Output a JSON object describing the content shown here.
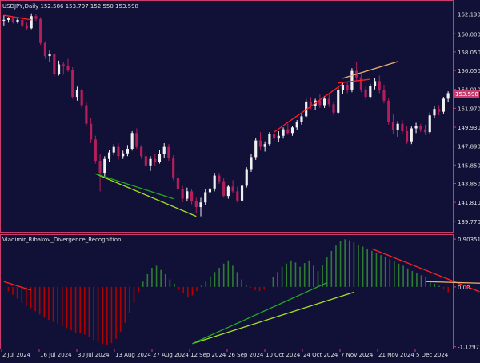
{
  "chart_data": [
    {
      "type": "candlestick",
      "symbol_label": "USDJPY,Daily  152.586 153.797 152.550 153.598",
      "ylim": [
        138.8,
        163.3
      ],
      "y_ticks": [
        "162.130",
        "160.000",
        "158.050",
        "156.050",
        "154.010",
        "151.970",
        "149.930",
        "147.890",
        "145.850",
        "143.850",
        "141.810",
        "139.770"
      ],
      "current_price_label": "153.598",
      "x_ticks": [
        "2 Jul 2024",
        "16 Jul 2024",
        "30 Jul 2024",
        "13 Aug 2024",
        "27 Aug 2024",
        "12 Sep 2024",
        "26 Sep 2024",
        "10 Oct 2024",
        "24 Oct 2024",
        "7 Nov 2024",
        "21 Nov 2024",
        "5 Dec 2024"
      ],
      "colors": {
        "bull": "#f0f0f0",
        "bear": "#b41e5a",
        "bg": "#111137",
        "frame": "#c83c6e",
        "text": "#e0e0e0"
      },
      "candles_ohlc": [
        [
          161.5,
          162.0,
          160.9,
          161.5
        ],
        [
          161.5,
          161.8,
          161.2,
          161.7
        ],
        [
          161.7,
          161.8,
          161.1,
          161.3
        ],
        [
          161.3,
          161.8,
          161.1,
          161.5
        ],
        [
          161.5,
          161.9,
          160.7,
          160.9
        ],
        [
          160.9,
          161.2,
          160.4,
          160.6
        ],
        [
          160.6,
          162.2,
          160.5,
          161.9
        ],
        [
          161.9,
          162.1,
          161.4,
          161.6
        ],
        [
          161.6,
          161.8,
          158.8,
          159.0
        ],
        [
          159.0,
          159.2,
          157.3,
          157.6
        ],
        [
          157.6,
          158.2,
          157.0,
          157.8
        ],
        [
          157.8,
          157.9,
          155.4,
          155.7
        ],
        [
          155.7,
          157.1,
          155.5,
          156.7
        ],
        [
          156.7,
          157.0,
          155.6,
          156.5
        ],
        [
          156.5,
          157.3,
          155.9,
          156.1
        ],
        [
          156.1,
          156.4,
          153.0,
          153.2
        ],
        [
          153.2,
          154.3,
          152.8,
          153.9
        ],
        [
          153.9,
          154.1,
          152.0,
          152.3
        ],
        [
          152.3,
          152.6,
          150.0,
          150.3
        ],
        [
          150.3,
          150.9,
          148.2,
          148.6
        ],
        [
          148.6,
          149.0,
          146.0,
          146.3
        ],
        [
          146.3,
          147.0,
          143.0,
          145.0
        ],
        [
          145.0,
          146.8,
          144.5,
          146.5
        ],
        [
          146.5,
          147.5,
          146.2,
          147.2
        ],
        [
          147.2,
          148.1,
          146.9,
          147.8
        ],
        [
          147.8,
          148.2,
          146.4,
          146.8
        ],
        [
          146.8,
          147.4,
          146.5,
          147.1
        ],
        [
          147.1,
          148.0,
          146.8,
          147.6
        ],
        [
          147.6,
          149.5,
          147.4,
          149.3
        ],
        [
          149.3,
          149.8,
          147.6,
          147.8
        ],
        [
          147.8,
          148.0,
          146.5,
          146.8
        ],
        [
          146.8,
          147.3,
          145.6,
          145.8
        ],
        [
          145.8,
          146.8,
          145.2,
          146.5
        ],
        [
          146.5,
          147.0,
          145.8,
          146.2
        ],
        [
          146.2,
          147.5,
          146.0,
          147.0
        ],
        [
          147.0,
          148.2,
          146.6,
          147.8
        ],
        [
          147.8,
          148.1,
          146.3,
          146.6
        ],
        [
          146.6,
          146.9,
          144.2,
          144.5
        ],
        [
          144.5,
          145.0,
          143.0,
          143.2
        ],
        [
          143.2,
          143.6,
          141.8,
          142.2
        ],
        [
          142.2,
          143.4,
          141.9,
          143.0
        ],
        [
          143.0,
          143.2,
          141.6,
          141.9
        ],
        [
          141.9,
          142.3,
          140.6,
          141.3
        ],
        [
          141.3,
          142.3,
          140.3,
          141.8
        ],
        [
          141.8,
          143.2,
          141.5,
          142.9
        ],
        [
          142.9,
          143.5,
          142.6,
          143.3
        ],
        [
          143.3,
          145.0,
          143.0,
          144.7
        ],
        [
          144.7,
          145.0,
          143.8,
          144.1
        ],
        [
          144.1,
          144.4,
          142.3,
          142.5
        ],
        [
          142.5,
          143.7,
          142.2,
          143.5
        ],
        [
          143.5,
          144.2,
          142.8,
          143.0
        ],
        [
          143.0,
          143.5,
          141.8,
          142.0
        ],
        [
          142.0,
          143.9,
          141.8,
          143.6
        ],
        [
          143.6,
          145.6,
          143.4,
          145.4
        ],
        [
          145.4,
          147.0,
          145.1,
          146.7
        ],
        [
          146.7,
          148.8,
          146.4,
          148.5
        ],
        [
          148.5,
          149.4,
          147.5,
          147.8
        ],
        [
          147.8,
          148.4,
          147.3,
          148.1
        ],
        [
          148.1,
          149.4,
          147.9,
          149.2
        ],
        [
          149.2,
          149.6,
          148.4,
          148.7
        ],
        [
          148.7,
          149.5,
          148.3,
          149.0
        ],
        [
          149.0,
          149.9,
          148.7,
          149.7
        ],
        [
          149.7,
          150.3,
          149.1,
          149.3
        ],
        [
          149.3,
          150.1,
          149.0,
          149.9
        ],
        [
          149.9,
          150.7,
          149.6,
          150.5
        ],
        [
          150.5,
          151.3,
          150.2,
          151.1
        ],
        [
          151.1,
          153.0,
          150.9,
          152.7
        ],
        [
          152.7,
          153.2,
          151.9,
          152.2
        ],
        [
          152.2,
          153.0,
          151.8,
          152.8
        ],
        [
          152.8,
          153.5,
          152.0,
          152.3
        ],
        [
          152.3,
          153.3,
          152.0,
          153.0
        ],
        [
          153.0,
          153.5,
          152.1,
          152.4
        ],
        [
          152.4,
          152.7,
          151.2,
          151.5
        ],
        [
          151.5,
          154.2,
          151.3,
          153.9
        ],
        [
          153.9,
          154.7,
          153.5,
          154.5
        ],
        [
          154.5,
          154.8,
          153.6,
          153.9
        ],
        [
          153.9,
          156.3,
          153.7,
          156.0
        ],
        [
          156.0,
          157.0,
          154.9,
          155.3
        ],
        [
          155.3,
          155.6,
          153.7,
          154.0
        ],
        [
          154.0,
          154.3,
          152.9,
          153.2
        ],
        [
          153.2,
          154.6,
          153.0,
          154.4
        ],
        [
          154.4,
          155.2,
          154.0,
          154.9
        ],
        [
          154.9,
          155.5,
          153.6,
          153.9
        ],
        [
          153.9,
          154.5,
          152.5,
          152.8
        ],
        [
          152.8,
          153.1,
          150.2,
          150.5
        ],
        [
          150.5,
          151.3,
          149.2,
          149.6
        ],
        [
          149.6,
          150.6,
          148.9,
          150.3
        ],
        [
          150.3,
          150.7,
          149.2,
          149.5
        ],
        [
          149.5,
          150.0,
          148.1,
          148.4
        ],
        [
          148.4,
          150.0,
          148.1,
          149.8
        ],
        [
          149.8,
          150.4,
          149.3,
          150.1
        ],
        [
          150.1,
          150.3,
          149.4,
          149.7
        ],
        [
          149.7,
          150.2,
          149.1,
          149.4
        ],
        [
          149.4,
          151.5,
          149.2,
          151.2
        ],
        [
          151.2,
          152.2,
          150.9,
          151.9
        ],
        [
          151.9,
          152.3,
          151.2,
          151.6
        ],
        [
          151.6,
          153.2,
          151.4,
          153.0
        ],
        [
          153.0,
          153.8,
          152.6,
          153.6
        ]
      ],
      "annotations": [
        {
          "price_panel_lines": [
            {
              "from": [
                0,
                162.0
              ],
              "to": [
                6,
                161.5
              ],
              "color": "#ff2020"
            },
            {
              "from": [
                20,
                144.9
              ],
              "to": [
                42,
                140.3
              ],
              "color": "#a8e020"
            },
            {
              "from": [
                20,
                144.9
              ],
              "to": [
                37,
                142.2
              ],
              "color": "#22aa22"
            },
            {
              "from": [
                59,
                149.4
              ],
              "to": [
                74,
                154.6
              ],
              "color": "#ff2020"
            },
            {
              "from": [
                74,
                155.2
              ],
              "to": [
                86,
                157.0
              ],
              "color": "#f0b070"
            },
            {
              "from": [
                73,
                154.7
              ],
              "to": [
                80,
                155.1
              ],
              "color": "#ff2020"
            }
          ]
        }
      ]
    },
    {
      "type": "bar",
      "title": "Vladimir_Ribakov_Divergence_Recognition",
      "ylim": [
        -1.165,
        0.95
      ],
      "y_ticks": [
        "0.903519",
        "0.00",
        "-1.12977"
      ],
      "colors": {
        "positive": "#2e7d32",
        "negative": "#b00000"
      },
      "values": [
        0.0,
        -0.08,
        -0.15,
        -0.22,
        -0.3,
        -0.36,
        -0.4,
        -0.46,
        -0.52,
        -0.58,
        -0.62,
        -0.66,
        -0.7,
        -0.74,
        -0.78,
        -0.82,
        -0.86,
        -0.88,
        -0.9,
        -0.94,
        -1.0,
        -1.04,
        -1.08,
        -1.1,
        -1.06,
        -0.98,
        -0.85,
        -0.68,
        -0.5,
        -0.3,
        -0.1,
        0.1,
        0.24,
        0.36,
        0.4,
        0.32,
        0.24,
        0.14,
        0.06,
        -0.05,
        -0.12,
        -0.2,
        -0.16,
        -0.08,
        0.02,
        0.1,
        0.2,
        0.28,
        0.36,
        0.44,
        0.5,
        0.4,
        0.28,
        0.14,
        0.04,
        -0.02,
        -0.06,
        -0.08,
        -0.05,
        0.0,
        0.18,
        0.28,
        0.38,
        0.44,
        0.5,
        0.46,
        0.38,
        0.45,
        0.5,
        0.4,
        0.3,
        0.42,
        0.56,
        0.68,
        0.78,
        0.86,
        0.9,
        0.88,
        0.84,
        0.8,
        0.76,
        0.72,
        0.68,
        0.64,
        0.6,
        0.56,
        0.52,
        0.48,
        0.44,
        0.4,
        0.35,
        0.3,
        0.26,
        0.22,
        0.18,
        0.12,
        0.06,
        0.02,
        -0.05,
        -0.1
      ],
      "annotations": [
        {
          "from": [
            0,
            0.1
          ],
          "to": [
            6,
            -0.06
          ],
          "color": "#ff2020"
        },
        {
          "from": [
            42,
            -1.07
          ],
          "to": [
            78,
            -0.1
          ],
          "color": "#a8e020"
        },
        {
          "from": [
            42,
            -1.07
          ],
          "to": [
            72,
            0.08
          ],
          "color": "#22aa22"
        },
        {
          "from": [
            82,
            0.72
          ],
          "to": [
            106,
            -0.09
          ],
          "color": "#ff2020"
        },
        {
          "from": [
            94,
            0.1
          ],
          "to": [
            114,
            0.05
          ],
          "color": "#f0b070"
        }
      ]
    }
  ]
}
